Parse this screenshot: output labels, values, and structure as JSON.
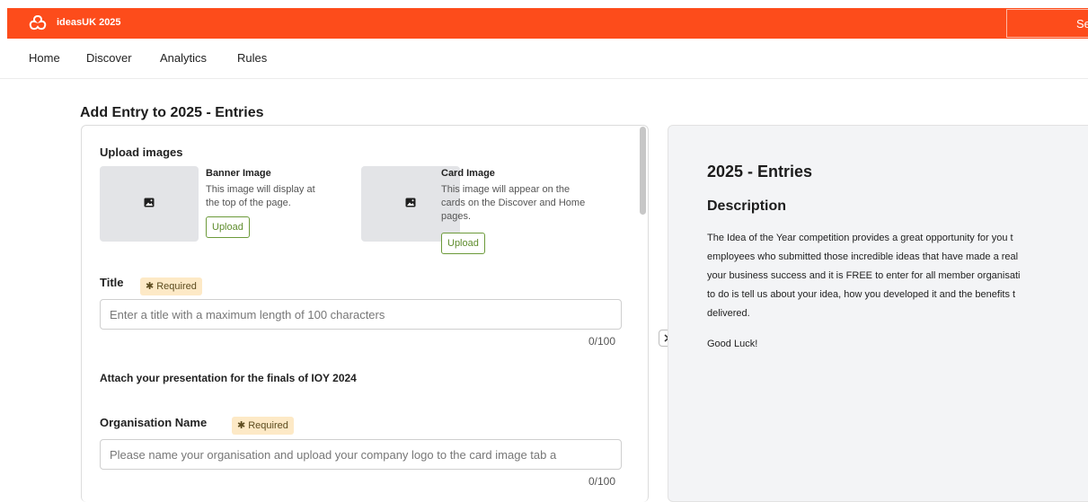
{
  "header": {
    "app_name": "ideasUK 2025",
    "top_button_label": "Se",
    "brand_color": "#fd4c1b",
    "logo_icon": "ideasuk-logo-icon"
  },
  "nav": {
    "items": [
      {
        "label": "Home"
      },
      {
        "label": "Discover"
      },
      {
        "label": "Analytics"
      },
      {
        "label": "Rules"
      }
    ]
  },
  "page": {
    "heading": "Add Entry to 2025 - Entries"
  },
  "form": {
    "upload_images_label": "Upload images",
    "banner": {
      "title": "Banner Image",
      "desc_lines": [
        "This image will display at",
        "the top of the page."
      ],
      "upload_label": "Upload",
      "icon": "image-icon"
    },
    "card": {
      "title": "Card Image",
      "desc_lines": [
        "This image will appear on the",
        "cards on the Discover and Home",
        "pages."
      ],
      "upload_label": "Upload",
      "icon": "image-icon"
    },
    "title_field": {
      "label": "Title",
      "required_label": "Required",
      "placeholder": "Enter a title with a maximum length of 100 characters",
      "counter": "0/100"
    },
    "attach_label": "Attach your presentation for the finals of IOY 2024",
    "org_field": {
      "label": "Organisation Name",
      "required_label": "Required",
      "placeholder": "Please  name your organisation and upload your company logo to the card image tab a",
      "counter": "0/100"
    }
  },
  "side_panel": {
    "title": "2025 - Entries",
    "subtitle": "Description",
    "desc_lines": [
      "The Idea of the Year competition provides a great opportunity for you t",
      "employees who submitted those incredible ideas that have made a real",
      "your business success and it is FREE to enter for all member organisati",
      "to do is tell us about your idea, how you developed it and the benefits t",
      "delivered."
    ],
    "closing": "Good Luck!",
    "toggle_icon": "chevron-right-icon"
  }
}
